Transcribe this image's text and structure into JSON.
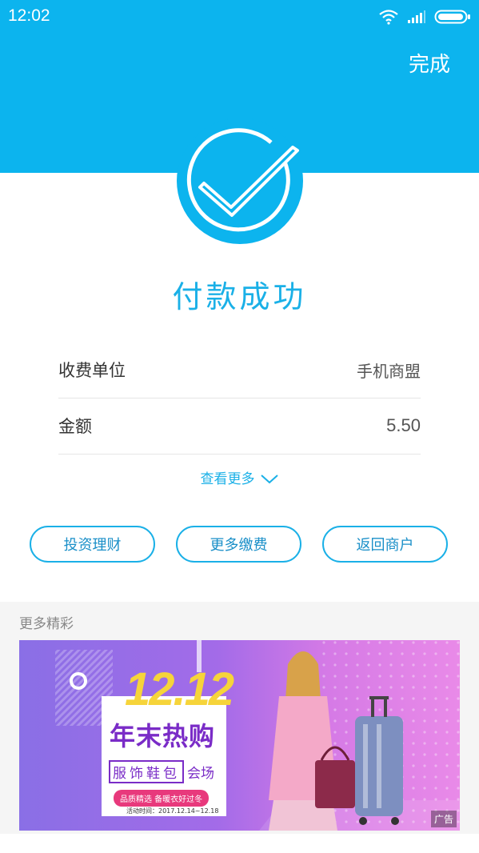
{
  "status_bar": {
    "time": "12:02"
  },
  "header": {
    "done_label": "完成"
  },
  "result": {
    "title": "付款成功"
  },
  "details": [
    {
      "label": "收费单位",
      "value": "手机商盟"
    },
    {
      "label": "金额",
      "value": "5.50"
    }
  ],
  "see_more_label": "查看更多",
  "actions": [
    {
      "label": "投资理财"
    },
    {
      "label": "更多缴费"
    },
    {
      "label": "返回商户"
    }
  ],
  "more_section": {
    "title": "更多精彩"
  },
  "banner": {
    "headline_number": "12.12",
    "headline": "年末热购",
    "subline_boxed": "服饰鞋包",
    "subline_tail": "会场",
    "pill_text": "品质精选 备暖衣好过冬",
    "date_text": "活动时间：2017.12.14~12.18",
    "ad_badge": "广告"
  },
  "colors": {
    "brand": "#0cb4ee",
    "accent_text": "#1ab0e7"
  }
}
